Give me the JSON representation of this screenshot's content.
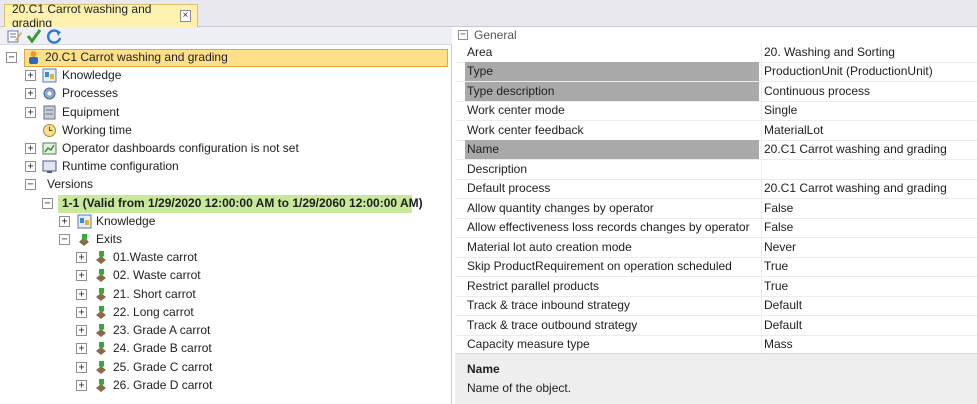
{
  "tab": {
    "title": "20.C1 Carrot washing and grading",
    "close": "×"
  },
  "toolbar": {
    "icons": [
      "edit-icon",
      "check-icon",
      "refresh-icon"
    ]
  },
  "tree": {
    "root": "20.C1 Carrot washing and grading",
    "children": [
      "Knowledge",
      "Processes",
      "Equipment",
      "Working time",
      "Operator dashboards configuration is not set",
      "Runtime configuration",
      "Versions"
    ],
    "version": "1-1 (Valid from 1/29/2020 12:00:00 AM to 1/29/2060 12:00:00 AM)",
    "version_children": [
      "Knowledge",
      "Exits"
    ],
    "exits": [
      "01.Waste carrot",
      "02. Waste carrot",
      "21. Short carrot",
      "22. Long carrot",
      "23. Grade A carrot",
      "24. Grade B carrot",
      "25. Grade C carrot",
      "26. Grade D carrot"
    ]
  },
  "properties": {
    "category": "General",
    "rows": [
      {
        "name": "Area",
        "value": "20. Washing and Sorting"
      },
      {
        "name": "Type",
        "value": "ProductionUnit (ProductionUnit)"
      },
      {
        "name": "Type description",
        "value": "Continuous process"
      },
      {
        "name": "Work center mode",
        "value": "Single"
      },
      {
        "name": "Work center feedback",
        "value": "MaterialLot"
      },
      {
        "name": "Name",
        "value": "20.C1 Carrot washing and grading"
      },
      {
        "name": "Description",
        "value": ""
      },
      {
        "name": "Default process",
        "value": "20.C1 Carrot washing and grading"
      },
      {
        "name": "Allow quantity changes by operator",
        "value": "False"
      },
      {
        "name": "Allow effectiveness loss records changes by operator",
        "value": "False"
      },
      {
        "name": "Material lot auto creation mode",
        "value": "Never"
      },
      {
        "name": "Skip ProductRequirement on operation scheduled",
        "value": "True"
      },
      {
        "name": "Restrict parallel products",
        "value": "True"
      },
      {
        "name": "Track & trace inbound strategy",
        "value": "Default"
      },
      {
        "name": "Track & trace outbound strategy",
        "value": "Default"
      },
      {
        "name": "Capacity measure type",
        "value": "Mass"
      }
    ],
    "description_title": "Name",
    "description_text": "Name of the object."
  },
  "colors": {
    "root_highlight": "#ffe08a",
    "version_highlight": "#c8e89a",
    "selected_property": "#a9a9a9"
  }
}
